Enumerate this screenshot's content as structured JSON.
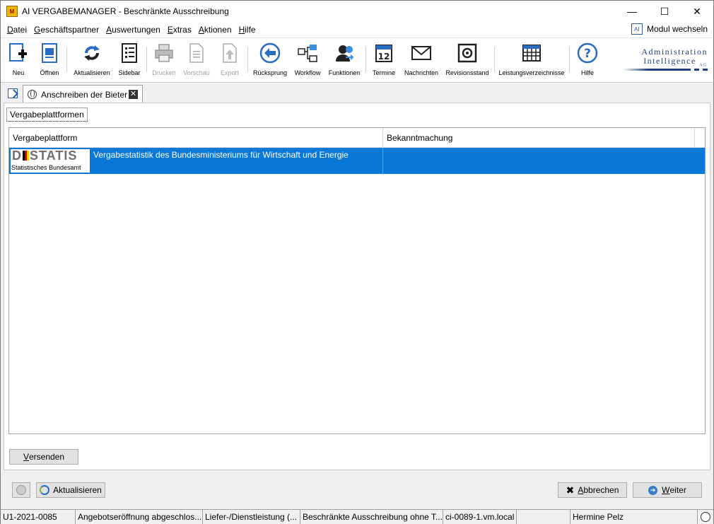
{
  "window": {
    "title": "AI VERGABEMANAGER - Beschränkte Ausschreibung",
    "app_icon_text": "M",
    "min": "—",
    "max": "☐",
    "close": "✕"
  },
  "menu": {
    "items": [
      {
        "u": "D",
        "rest": "atei"
      },
      {
        "u": "G",
        "rest": "eschäftspartner"
      },
      {
        "u": "A",
        "rest": "uswertungen"
      },
      {
        "u": "E",
        "rest": "xtras"
      },
      {
        "u": "A",
        "rest": "ktionen"
      },
      {
        "u": "H",
        "rest": "ilfe"
      }
    ],
    "modul_wechseln": "Modul wechseln",
    "modul_icon_text": "AI"
  },
  "toolbar": {
    "buttons": [
      {
        "label": "Neu",
        "icon": "new-document-icon"
      },
      {
        "label": "Öffnen",
        "icon": "open-document-icon"
      },
      {
        "label": "Aktualisieren",
        "icon": "refresh-icon"
      },
      {
        "label": "Sidebar",
        "icon": "sidebar-icon"
      },
      {
        "label": "Drucken",
        "icon": "printer-icon"
      },
      {
        "label": "Vorschau",
        "icon": "preview-icon"
      },
      {
        "label": "Export",
        "icon": "export-icon"
      },
      {
        "label": "Rücksprung",
        "icon": "back-arrow-icon"
      },
      {
        "label": "Workflow",
        "icon": "workflow-icon"
      },
      {
        "label": "Funktionen",
        "icon": "functions-icon"
      },
      {
        "label": "Termine",
        "icon": "calendar-icon"
      },
      {
        "label": "Nachrichten",
        "icon": "envelope-icon"
      },
      {
        "label": "Revisionsstand",
        "icon": "safe-icon"
      },
      {
        "label": "Leistungsverzeichnisse",
        "icon": "table-icon"
      },
      {
        "label": "Hilfe",
        "icon": "help-icon"
      }
    ],
    "calendar_day": "12",
    "logo_line1": "Administration",
    "logo_line2": "Intelligence",
    "logo_suffix": "AG"
  },
  "tabs": {
    "document_tab": "Anschreiben der Bieter",
    "close": "✕"
  },
  "content": {
    "subtab": "Vergabeplattformen",
    "columns": [
      "Vergabeplattform",
      "Bekanntmachung"
    ],
    "rows": [
      {
        "logo_word_left": "D",
        "logo_word_right": "STATIS",
        "logo_sub": "Statistisches Bundesamt",
        "platform": "Vergabestatistik des Bundesministeriums für Wirtschaft und Energie",
        "bekanntmachung": ""
      }
    ],
    "versenden_u": "V",
    "versenden_rest": "ersenden"
  },
  "footer": {
    "aktualisieren": "Aktualisieren",
    "abbrechen_u": "A",
    "abbrechen_rest": "bbrechen",
    "weiter_u": "W",
    "weiter_rest": "eiter"
  },
  "statusbar": [
    "U1-2021-0085",
    "Angebotseröffnung abgeschlos...",
    "Liefer-/Dienstleistung (...",
    "Beschränkte Ausschreibung ohne T...",
    "ci-0089-1.vm.local",
    "",
    "Hermine Pelz"
  ],
  "colors": {
    "selection": "#0a78d7",
    "icon_blue": "#2c6cc0"
  }
}
